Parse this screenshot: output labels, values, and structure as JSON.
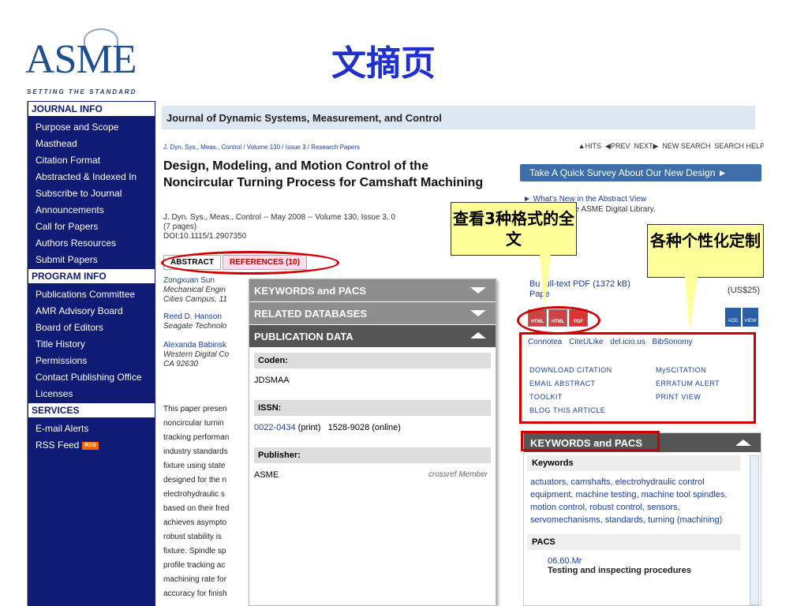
{
  "slide": {
    "title": "文摘页"
  },
  "logo": {
    "mark": "ASME",
    "tagline": "SETTING THE STANDARD"
  },
  "sidebar": {
    "sections": [
      {
        "heading": "JOURNAL INFO",
        "items": [
          "Purpose and Scope",
          "Masthead",
          "Citation Format",
          "Abstracted & Indexed In",
          "Subscribe to Journal",
          "Announcements",
          "Call for Papers",
          "Authors Resources",
          "Submit Papers"
        ]
      },
      {
        "heading": "PROGRAM INFO",
        "items": [
          "Publications Committee",
          "AMR Advisory Board",
          "Board of Editors",
          "Title History",
          "Permissions",
          "Contact Publishing Office",
          "Licenses"
        ]
      },
      {
        "heading": "SERVICES",
        "items": [
          "E-mail Alerts",
          "RSS Feed"
        ]
      }
    ],
    "rss_badge": "RSS"
  },
  "journal": {
    "title": "Journal of Dynamic Systems, Measurement, and Control"
  },
  "breadcrumb": "J. Dyn. Sys., Meas., Control / Volume 130 / Issue 3 / Research Papers",
  "nav": {
    "hits": "▲HITS",
    "prev": "◀PREV",
    "next": "NEXT▶",
    "new_search": "NEW SEARCH",
    "search_help": "SEARCH HELP"
  },
  "article": {
    "title": "Design, Modeling, and Motion Control of the Noncircular Turning Process for Camshaft Machining",
    "citation": "J. Dyn. Sys., Meas., Control -- May 2008 -- Volume 130, Issue 3, 0",
    "pages": "(7 pages)",
    "doi": "DOI:10.1115/1.2907350"
  },
  "tabs": {
    "abstract": "ABSTRACT",
    "references": "REFERENCES (10)"
  },
  "authors": [
    {
      "name": "Zongxuan Sun",
      "affil": "Mechanical Engin",
      "affil2": "Cities Campus, 11"
    },
    {
      "name": "Reed D. Hanson",
      "affil": "Seagate Technolo",
      "affil2": ""
    },
    {
      "name": "Alexanda Babinsk",
      "affil": "Western Digital Co",
      "affil2": "CA 92630"
    }
  ],
  "abstract_lines": [
    "This paper presen",
    "noncircular turnin",
    "tracking performan",
    "industry standards",
    "fixture using state",
    "designed for the n",
    "electrohydraulic s",
    "based on their fred",
    "achieves asympto",
    "robust stability is",
    "fixture. Spindle sp",
    "profile tracking ac",
    "machining rate for",
    "accuracy for finish"
  ],
  "popup": {
    "keywords_bar": "KEYWORDS and PACS",
    "related_bar": "RELATED DATABASES",
    "pubdata_bar": "PUBLICATION DATA",
    "coden_label": "Coden:",
    "coden_value": "JDSMAA",
    "issn_label": "ISSN:",
    "issn_print": "0022-0434",
    "issn_print_suffix": "(print)",
    "issn_online": "1528-9028 (online)",
    "publisher_label": "Publisher:",
    "publisher_value": "ASME",
    "crossref": "crossref Member"
  },
  "survey": {
    "label": "Take A Quick Survey About Our New Design ►"
  },
  "whats_new": {
    "link": "► What's New in the Abstract View",
    "line2": "t logged into the ASME Digital Library."
  },
  "buy": {
    "line1": "Bu  full-text PDF (1372 kB)",
    "line2": "Pape",
    "price": "(US$25)"
  },
  "formats": [
    "HTML",
    "HTML",
    "PDF"
  ],
  "tool_icons": [
    "ADD",
    "VIEW"
  ],
  "bookmarks": [
    "Connotea",
    "CiteULike",
    "del.icio.us",
    "BibSonomy"
  ],
  "actions": [
    "DOWNLOAD CITATION",
    "MySCITATION",
    "EMAIL ABSTRACT",
    "ERRATUM ALERT",
    "TOOLKIT",
    "PRINT VIEW",
    "BLOG THIS ARTICLE"
  ],
  "kw_panel": {
    "bar": "KEYWORDS and PACS",
    "keywords_label": "Keywords",
    "keywords_text": "actuators, camshafts, electrohydraulic control equipment, machine testing, machine tool spindles, motion control, robust control, sensors, servomechanisms, standards, turning (machining)",
    "pacs_label": "PACS",
    "pacs_code": "06.60.Mr",
    "pacs_desc": "Testing and inspecting procedures"
  },
  "callouts": {
    "formats": "查看3种格式的全文",
    "custom": "各种个性化定制"
  },
  "colors": {
    "sidebar": "#0f1b74",
    "annotation": "#d00000",
    "callout_bg": "#ffff99",
    "title": "#1f2fd0"
  }
}
